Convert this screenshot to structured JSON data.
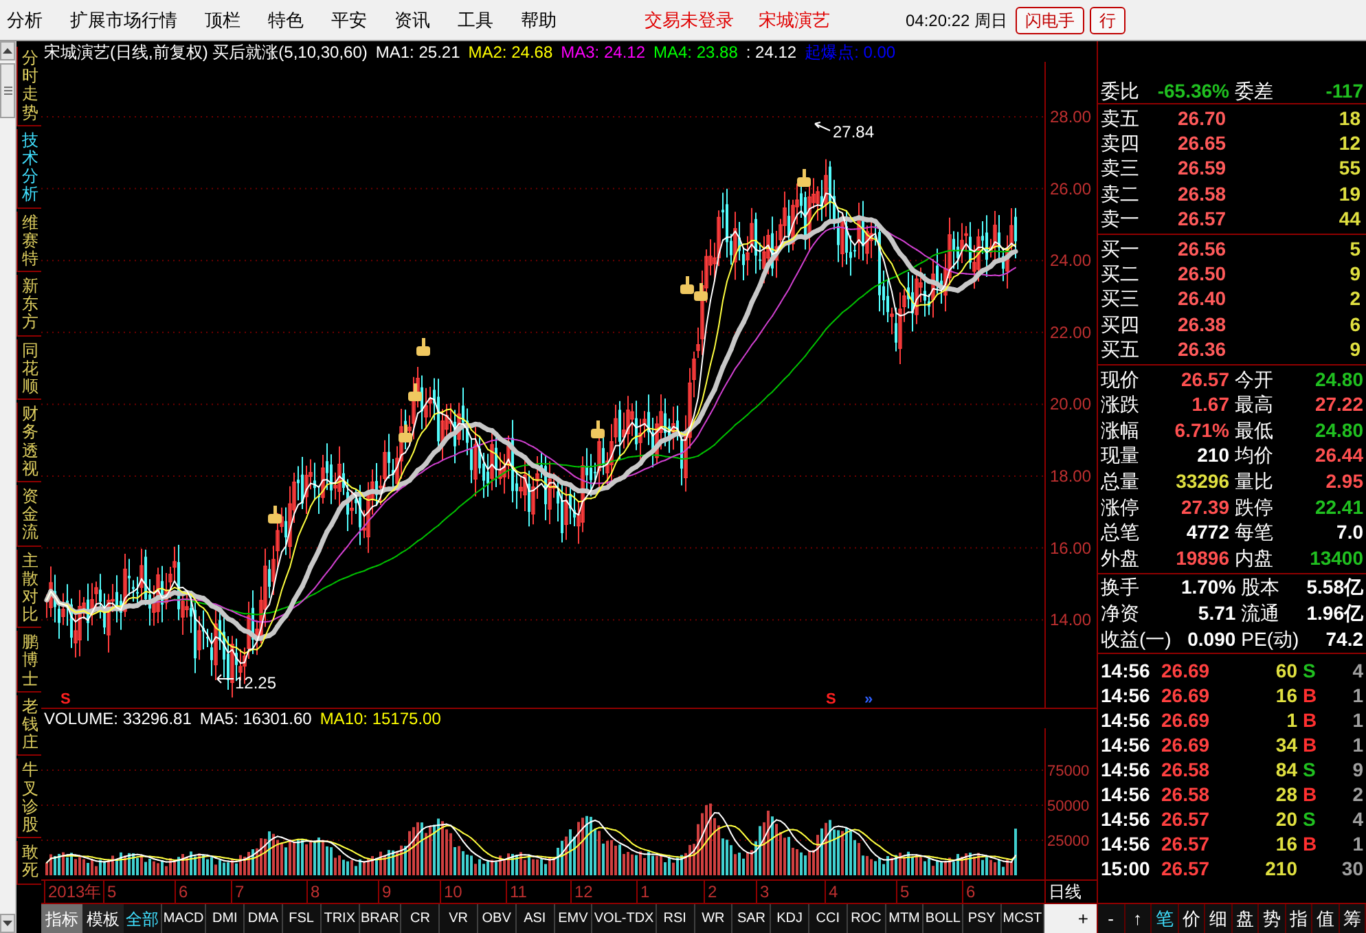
{
  "menu_items": [
    "分析",
    "扩展市场行情",
    "顶栏",
    "特色",
    "平安",
    "资讯",
    "工具",
    "帮助"
  ],
  "login_status": "交易未登录",
  "stock_name": "宋城演艺",
  "clock": "04:20:22 周日",
  "toolbar_buttons": [
    {
      "label": "闪电手",
      "kind": "boxed"
    },
    {
      "label": "行",
      "kind": "boxed"
    }
  ],
  "side_tabs": [
    {
      "label": "分时走势",
      "selected": false
    },
    {
      "label": "技术分析",
      "selected": true
    },
    {
      "label": "维赛特",
      "selected": false
    },
    {
      "label": "新东方",
      "selected": false
    },
    {
      "label": "同花顺",
      "selected": false
    },
    {
      "label": "财务透视",
      "selected": false
    },
    {
      "label": "资金流",
      "selected": false
    },
    {
      "label": "主散对比",
      "selected": false
    },
    {
      "label": "鹏博士",
      "selected": false
    },
    {
      "label": "老钱庄",
      "selected": false
    },
    {
      "label": "牛叉诊股",
      "selected": false
    },
    {
      "label": "敢死",
      "selected": false
    }
  ],
  "chart_header": [
    {
      "text": "宋城演艺(日线,前复权) 买后就涨(5,10,30,60)",
      "color": "#ffffff"
    },
    {
      "text": "MA1: 25.21",
      "color": "#ffffff"
    },
    {
      "text": "MA2: 24.68",
      "color": "#ffff00"
    },
    {
      "text": "MA3: 24.12",
      "color": "#ff00ff"
    },
    {
      "text": "MA4: 23.88",
      "color": "#00ff00"
    },
    {
      "text": ": 24.12",
      "color": "#ffffff"
    },
    {
      "text": "起爆点: 0.00",
      "color": "#0000ff"
    }
  ],
  "price_axis": [
    "28.00",
    "26.00",
    "24.00",
    "22.00",
    "20.00",
    "18.00",
    "16.00",
    "14.00"
  ],
  "high_mark": "27.84",
  "low_mark": "12.25",
  "signal_marks": [
    {
      "text": "S",
      "color": "#ff2020"
    },
    {
      "text": "S",
      "color": "#ff2020"
    },
    {
      "text": "»",
      "color": "#3060ff"
    }
  ],
  "volume_header": [
    {
      "text": "VOLUME: 33296.81",
      "color": "#ffffff"
    },
    {
      "text": "MA5: 16301.60",
      "color": "#ffffff"
    },
    {
      "text": "MA10: 15175.00",
      "color": "#ffff00"
    }
  ],
  "volume_axis": [
    "75000",
    "50000",
    "25000"
  ],
  "month_axis": [
    "2013年",
    "5",
    "6",
    "7",
    "8",
    "9",
    "10",
    "11",
    "12",
    "1",
    "2",
    "3",
    "4",
    "5",
    "6"
  ],
  "period_label": "日线",
  "panel_buttons": [
    {
      "label": "指标",
      "selected": true
    },
    {
      "label": "模板",
      "selected": false
    }
  ],
  "indicator_tabs": [
    {
      "label": "全部",
      "selected": true
    },
    {
      "label": "MACD",
      "selected": false
    },
    {
      "label": "DMI",
      "selected": false
    },
    {
      "label": "DMA",
      "selected": false
    },
    {
      "label": "FSL",
      "selected": false
    },
    {
      "label": "TRIX",
      "selected": false
    },
    {
      "label": "BRAR",
      "selected": false
    },
    {
      "label": "CR",
      "selected": false
    },
    {
      "label": "VR",
      "selected": false
    },
    {
      "label": "OBV",
      "selected": false
    },
    {
      "label": "ASI",
      "selected": false
    },
    {
      "label": "EMV",
      "selected": false
    },
    {
      "label": "VOL-TDX",
      "selected": false
    },
    {
      "label": "RSI",
      "selected": false
    },
    {
      "label": "WR",
      "selected": false
    },
    {
      "label": "SAR",
      "selected": false
    },
    {
      "label": "KDJ",
      "selected": false
    },
    {
      "label": "CCI",
      "selected": false
    },
    {
      "label": "ROC",
      "selected": false
    },
    {
      "label": "MTM",
      "selected": false
    },
    {
      "label": "BOLL",
      "selected": false
    },
    {
      "label": "PSY",
      "selected": false
    },
    {
      "label": "MCST",
      "selected": false
    }
  ],
  "add_button": "+",
  "order_book": {
    "ratio": [
      {
        "label": "委比",
        "value": "-65.36%",
        "color": "#20c020"
      },
      {
        "label": "委差",
        "value": "-117",
        "color": "#20c020"
      }
    ],
    "asks": [
      {
        "label": "卖五",
        "price": "26.70",
        "volume": "18"
      },
      {
        "label": "卖四",
        "price": "26.65",
        "volume": "12"
      },
      {
        "label": "卖三",
        "price": "26.59",
        "volume": "55"
      },
      {
        "label": "卖二",
        "price": "26.58",
        "volume": "19"
      },
      {
        "label": "卖一",
        "price": "26.57",
        "volume": "44"
      }
    ],
    "bids": [
      {
        "label": "买一",
        "price": "26.56",
        "volume": "5"
      },
      {
        "label": "买二",
        "price": "26.50",
        "volume": "9"
      },
      {
        "label": "买三",
        "price": "26.40",
        "volume": "2"
      },
      {
        "label": "买四",
        "price": "26.38",
        "volume": "6"
      },
      {
        "label": "买五",
        "price": "26.36",
        "volume": "9"
      }
    ]
  },
  "quote": [
    {
      "label": "现价",
      "value": "26.57",
      "color": "#ff5050"
    },
    {
      "label": "今开",
      "value": "24.80",
      "color": "#20c020"
    },
    {
      "label": "涨跌",
      "value": "1.67",
      "color": "#ff5050"
    },
    {
      "label": "最高",
      "value": "27.22",
      "color": "#ff5050"
    },
    {
      "label": "涨幅",
      "value": "6.71%",
      "color": "#ff5050"
    },
    {
      "label": "最低",
      "value": "24.80",
      "color": "#20c020"
    },
    {
      "label": "现量",
      "value": "210",
      "color": "#ffffff"
    },
    {
      "label": "均价",
      "value": "26.44",
      "color": "#ff5050"
    },
    {
      "label": "总量",
      "value": "33296",
      "color": "#e0e040"
    },
    {
      "label": "量比",
      "value": "2.95",
      "color": "#ff5050"
    },
    {
      "label": "涨停",
      "value": "27.39",
      "color": "#ff5050"
    },
    {
      "label": "跌停",
      "value": "22.41",
      "color": "#20c020"
    },
    {
      "label": "总笔",
      "value": "4772",
      "color": "#ffffff"
    },
    {
      "label": "每笔",
      "value": "7.0",
      "color": "#ffffff"
    },
    {
      "label": "外盘",
      "value": "19896",
      "color": "#ff5050"
    },
    {
      "label": "内盘",
      "value": "13400",
      "color": "#20c020"
    }
  ],
  "fundamentals": [
    {
      "label": "换手",
      "value": "1.70%"
    },
    {
      "label": "股本",
      "value": "5.58亿"
    },
    {
      "label": "净资",
      "value": "5.71"
    },
    {
      "label": "流通",
      "value": "1.96亿"
    },
    {
      "label": "收益(一)",
      "value": "0.090"
    },
    {
      "label": "PE(动)",
      "value": "74.2"
    }
  ],
  "ticks": [
    {
      "time": "14:56",
      "price": "26.69",
      "volume": "60",
      "side": "S",
      "color": "#20c020",
      "count": "4"
    },
    {
      "time": "14:56",
      "price": "26.69",
      "volume": "16",
      "side": "B",
      "color": "#ff3030",
      "count": "1"
    },
    {
      "time": "14:56",
      "price": "26.69",
      "volume": "1",
      "side": "B",
      "color": "#ff3030",
      "count": "1"
    },
    {
      "time": "14:56",
      "price": "26.69",
      "volume": "34",
      "side": "B",
      "color": "#ff3030",
      "count": "1"
    },
    {
      "time": "14:56",
      "price": "26.58",
      "volume": "84",
      "side": "S",
      "color": "#20c020",
      "count": "9"
    },
    {
      "time": "14:56",
      "price": "26.58",
      "volume": "28",
      "side": "B",
      "color": "#ff3030",
      "count": "2"
    },
    {
      "time": "14:56",
      "price": "26.57",
      "volume": "20",
      "side": "S",
      "color": "#20c020",
      "count": "4"
    },
    {
      "time": "14:56",
      "price": "26.57",
      "volume": "16",
      "side": "B",
      "color": "#ff3030",
      "count": "1"
    },
    {
      "time": "15:00",
      "price": "26.57",
      "volume": "210",
      "count": "30"
    }
  ],
  "panel_tabs": [
    {
      "label": "-",
      "selected": false
    },
    {
      "label": "↑",
      "selected": false
    },
    {
      "label": "笔",
      "selected": true
    },
    {
      "label": "价",
      "selected": false
    },
    {
      "label": "细",
      "selected": false
    },
    {
      "label": "盘",
      "selected": false
    },
    {
      "label": "势",
      "selected": false
    },
    {
      "label": "指",
      "selected": false
    },
    {
      "label": "值",
      "selected": false
    },
    {
      "label": "筹",
      "selected": false
    }
  ]
}
